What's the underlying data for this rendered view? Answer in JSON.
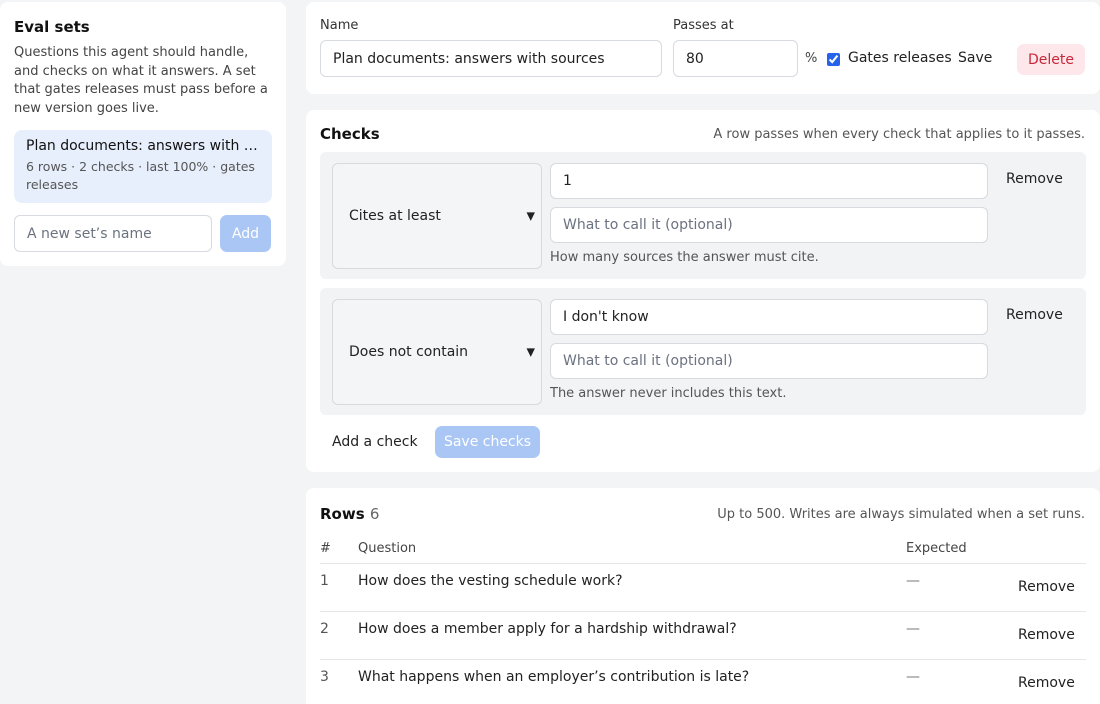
{
  "sidebar": {
    "title": "Eval sets",
    "description": "Questions this agent should handle, and checks on what it answers. A set that gates releases must pass before a new version goes live.",
    "sets": [
      {
        "name": "Plan documents: answers with sources",
        "meta": "6 rows · 2 checks · last 100% · gates releases"
      }
    ],
    "new_set_placeholder": "A new set’s name",
    "add_label": "Add"
  },
  "settings": {
    "name_label": "Name",
    "name_value": "Plan documents: answers with sources",
    "passes_label": "Passes at",
    "passes_value": "80",
    "percent": "%",
    "gates_label": "Gates releases",
    "gates_checked": true,
    "save_label": "Save",
    "delete_label": "Delete"
  },
  "checks": {
    "title": "Checks",
    "note": "A row passes when every check that applies to it passes.",
    "items": [
      {
        "type": "Cites at least",
        "value": "1",
        "name_placeholder": "What to call it (optional)",
        "hint": "How many sources the answer must cite.",
        "remove": "Remove"
      },
      {
        "type": "Does not contain",
        "value": "I don't know",
        "name_placeholder": "What to call it (optional)",
        "hint": "The answer never includes this text.",
        "remove": "Remove"
      }
    ],
    "add_check_label": "Add a check",
    "save_checks_label": "Save checks"
  },
  "rows": {
    "title": "Rows",
    "count": "6",
    "note": "Up to 500. Writes are always simulated when a set runs.",
    "columns": {
      "num": "#",
      "question": "Question",
      "expected": "Expected"
    },
    "items": [
      {
        "num": "1",
        "question": "How does the vesting schedule work?",
        "expected": "—",
        "remove": "Remove"
      },
      {
        "num": "2",
        "question": "How does a member apply for a hardship withdrawal?",
        "expected": "—",
        "remove": "Remove"
      },
      {
        "num": "3",
        "question": "What happens when an employer’s contribution is late?",
        "expected": "—",
        "remove": "Remove"
      }
    ]
  },
  "colors": {
    "accent": "#2563eb",
    "accent_disabled": "#a9c6f5",
    "danger": "#c62839",
    "danger_bg": "#fde7ea",
    "selected_bg": "#e8effc"
  }
}
